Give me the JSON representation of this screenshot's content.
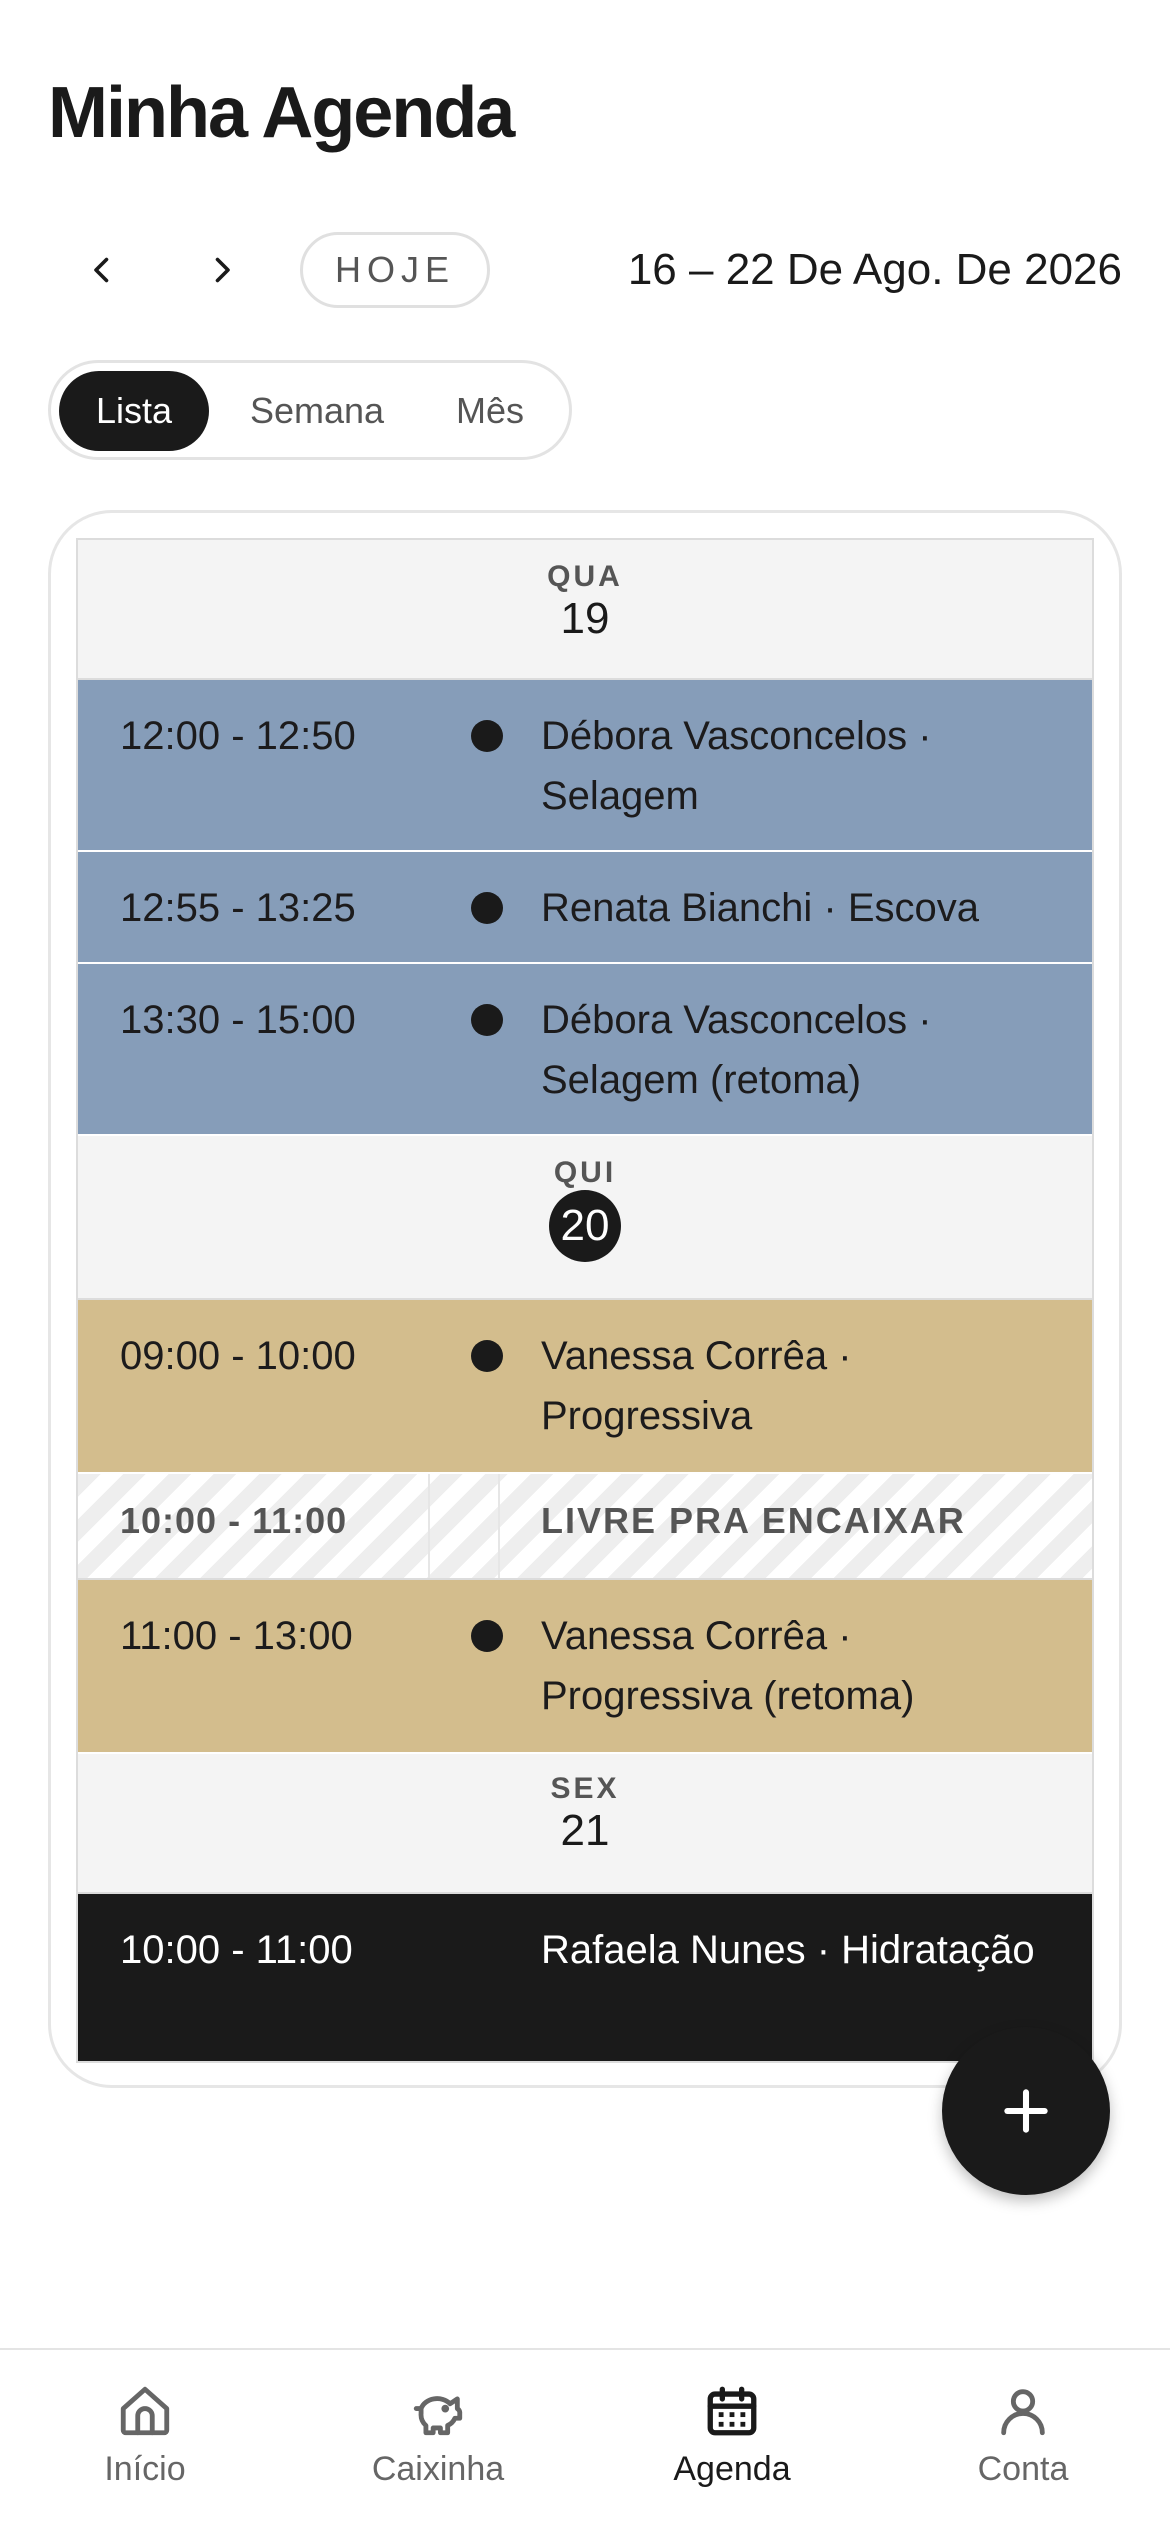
{
  "title": "Minha Agenda",
  "nav": {
    "today_label": "HOJE",
    "date_range": "16 – 22 De Ago. De 2026"
  },
  "views": {
    "list": "Lista",
    "week": "Semana",
    "month": "Mês",
    "selected": "Lista"
  },
  "days": [
    {
      "abbr": "QUA",
      "num": "19",
      "appointments": [
        {
          "time": "12:00 - 12:50",
          "desc": "Débora Vasconcelos · Selagem",
          "color": "#869db9"
        },
        {
          "time": "12:55 - 13:25",
          "desc": "Renata Bianchi · Escova",
          "color": "#869db9"
        },
        {
          "time": "13:30 - 15:00",
          "desc": "Débora Vasconcelos · Selagem (retoma)",
          "color": "#869db9"
        }
      ]
    },
    {
      "abbr": "QUI",
      "num": "20",
      "appointments": [
        {
          "time": "09:00 - 10:00",
          "desc": "Vanessa Corrêa · Progressiva",
          "color": "#d3bd8d"
        },
        {
          "time": "10:00 - 11:00",
          "desc": "LIVRE PRA ENCAIXAR",
          "free": true
        },
        {
          "time": "11:00 - 13:00",
          "desc": "Vanessa Corrêa · Progressiva (retoma)",
          "color": "#d3bd8d"
        }
      ]
    },
    {
      "abbr": "SEX",
      "num": "21",
      "appointments": [
        {
          "time": "10:00 - 11:00",
          "desc": "Rafaela Nunes · Hidratação",
          "color": "#1a1a1a"
        }
      ]
    }
  ],
  "bottom_nav": {
    "items": [
      {
        "label": "Início",
        "icon": "home-icon"
      },
      {
        "label": "Caixinha",
        "icon": "piggy-bank-icon"
      },
      {
        "label": "Agenda",
        "icon": "calendar-icon"
      },
      {
        "label": "Conta",
        "icon": "user-icon"
      }
    ],
    "active": "Agenda"
  }
}
